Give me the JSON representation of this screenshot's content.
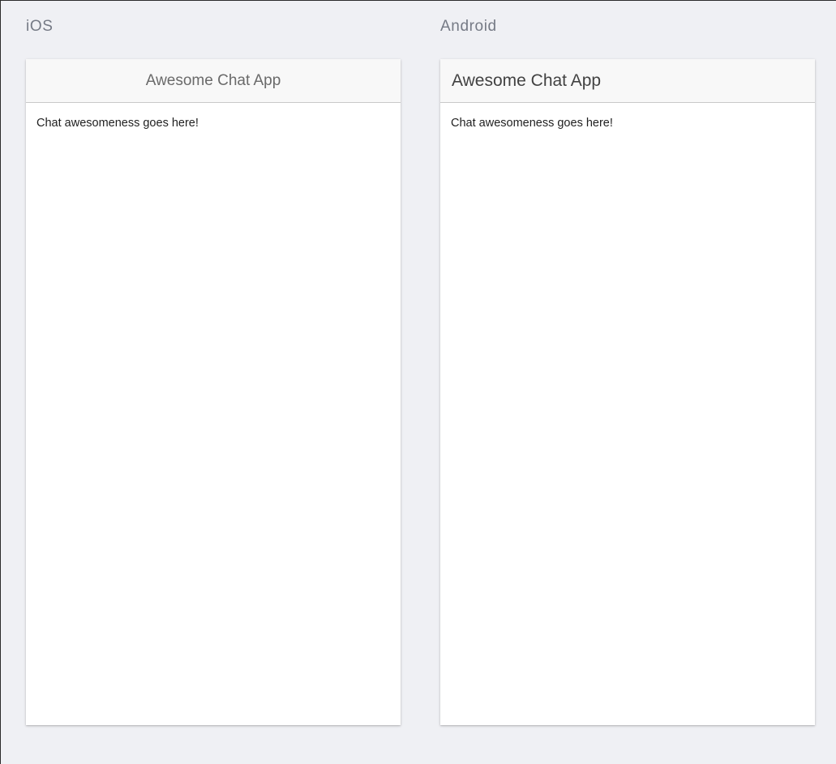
{
  "platforms": [
    {
      "label": "iOS",
      "toolbar": {
        "title": "Awesome Chat App"
      },
      "content": {
        "text": "Chat awesomeness goes here!"
      }
    },
    {
      "label": "Android",
      "toolbar": {
        "title": "Awesome Chat App"
      },
      "content": {
        "text": "Chat awesomeness goes here!"
      }
    }
  ],
  "colors": {
    "background": "#eff0f4",
    "platform_label": "#757a85",
    "toolbar": "#f8f8f8",
    "toolbar_border": "#c9c9c9",
    "ios_title": "#6a6a6a",
    "android_title": "#424242",
    "content_text": "#1f1f1f"
  }
}
